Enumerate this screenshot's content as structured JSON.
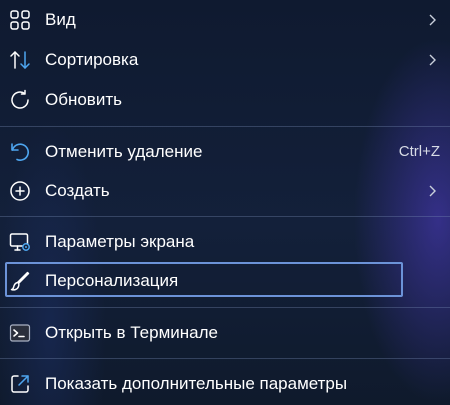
{
  "menu": {
    "items": [
      {
        "label": "Вид",
        "icon": "grid-icon",
        "submenu": true
      },
      {
        "label": "Сортировка",
        "icon": "sort-arrows-icon",
        "submenu": true
      },
      {
        "label": "Обновить",
        "icon": "refresh-icon"
      },
      {
        "label": "Отменить удаление",
        "icon": "undo-icon",
        "shortcut": "Ctrl+Z"
      },
      {
        "label": "Создать",
        "icon": "plus-circle-icon",
        "submenu": true
      },
      {
        "label": "Параметры экрана",
        "icon": "display-settings-icon"
      },
      {
        "label": "Персонализация",
        "icon": "brush-icon",
        "focused": true
      },
      {
        "label": "Открыть в Терминале",
        "icon": "terminal-icon"
      },
      {
        "label": "Показать дополнительные параметры",
        "icon": "external-link-icon"
      }
    ],
    "accent_color": "#4ea6f0",
    "focus_border_color": "#6c93d8"
  }
}
